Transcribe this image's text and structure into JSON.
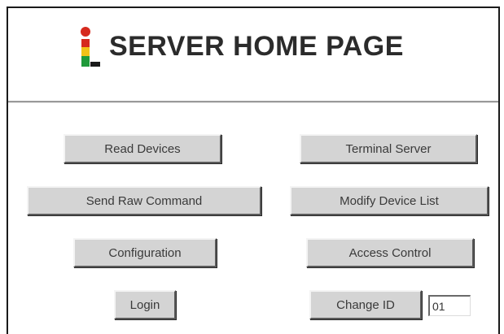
{
  "header": {
    "title": "SERVER HOME PAGE",
    "logo_icon": "i-logo-icon"
  },
  "buttons": {
    "read_devices": "Read Devices",
    "terminal_server": "Terminal Server",
    "send_raw_command": "Send Raw Command",
    "modify_device_list": "Modify Device List",
    "configuration": "Configuration",
    "access_control": "Access Control",
    "login": "Login",
    "change_id": "Change ID"
  },
  "id_field": {
    "value": "01"
  },
  "colors": {
    "logo_red": "#d62a1e",
    "logo_yellow": "#f2c318",
    "logo_green": "#1f9a3a",
    "button_face": "#d4d4d4"
  }
}
